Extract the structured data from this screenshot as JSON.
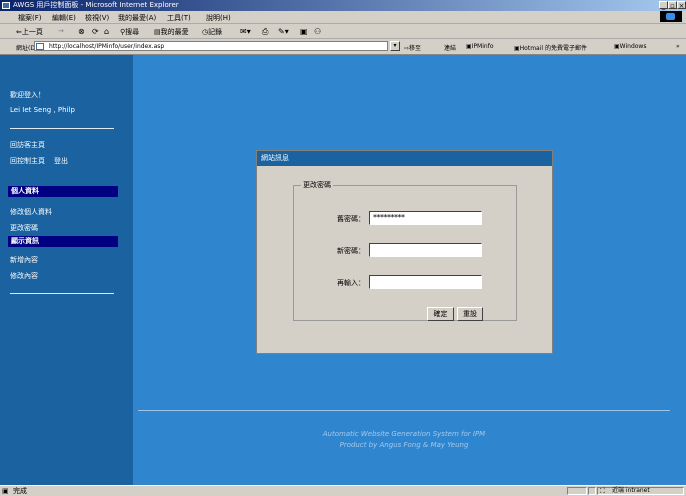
{
  "window": {
    "title": "AWGS 用戶控制面板 - Microsoft Internet Explorer",
    "minimize": "_",
    "restore": "▫",
    "close": "×"
  },
  "menubar": {
    "items": [
      "檔案(F)",
      "編輯(E)",
      "檢視(V)",
      "我的最愛(A)",
      "工具(T)",
      "說明(H)"
    ]
  },
  "toolbar": {
    "back": "⇐上一頁",
    "forward": "→",
    "search": "搜尋",
    "favorites": "我的最愛",
    "history": "記錄"
  },
  "addressbar": {
    "label": "網址(D)",
    "url": "http://localhost/IPMinfo/user/index.asp",
    "go": "移至",
    "links_label": "連結",
    "links": [
      "IPMinfo",
      "Hotmail 的免費電子郵件",
      "Windows"
    ],
    "more": "»"
  },
  "sidebar": {
    "welcome": "歡迎登入！",
    "user_name": "Lei Iet Seng , Philp",
    "link_home": "回訪客主頁",
    "link_control": "回控制主頁",
    "link_logout": "登出",
    "section_personal": "個人資料",
    "item_edit_profile": "修改個人資料",
    "item_change_password": "更改密碼",
    "section_display": "顯示資訊",
    "item_add_content": "新增內容",
    "item_edit_content": "修改內容"
  },
  "footer": {
    "line1": "Automatic Website Generation System for IPM",
    "line2": "Product by Angus Fong & May Yeung"
  },
  "dialog": {
    "title": "網站訊息",
    "legend": "更改密碼",
    "old_password_label": "舊密碼：",
    "old_password_value": "*********",
    "new_password_label": "新密碼：",
    "new_password_value": "",
    "confirm_password_label": "再輸入：",
    "confirm_password_value": "",
    "ok_button": "確定",
    "reset_button": "重設"
  },
  "statusbar": {
    "status": "完成",
    "zone": "近端 intranet"
  },
  "colors": {
    "page_bg": "#2f86cf",
    "sidebar_bg": "#1a62a0",
    "section_header": "#000080",
    "dialog_header": "#1a62a0",
    "title_bar": "#0a246a"
  }
}
